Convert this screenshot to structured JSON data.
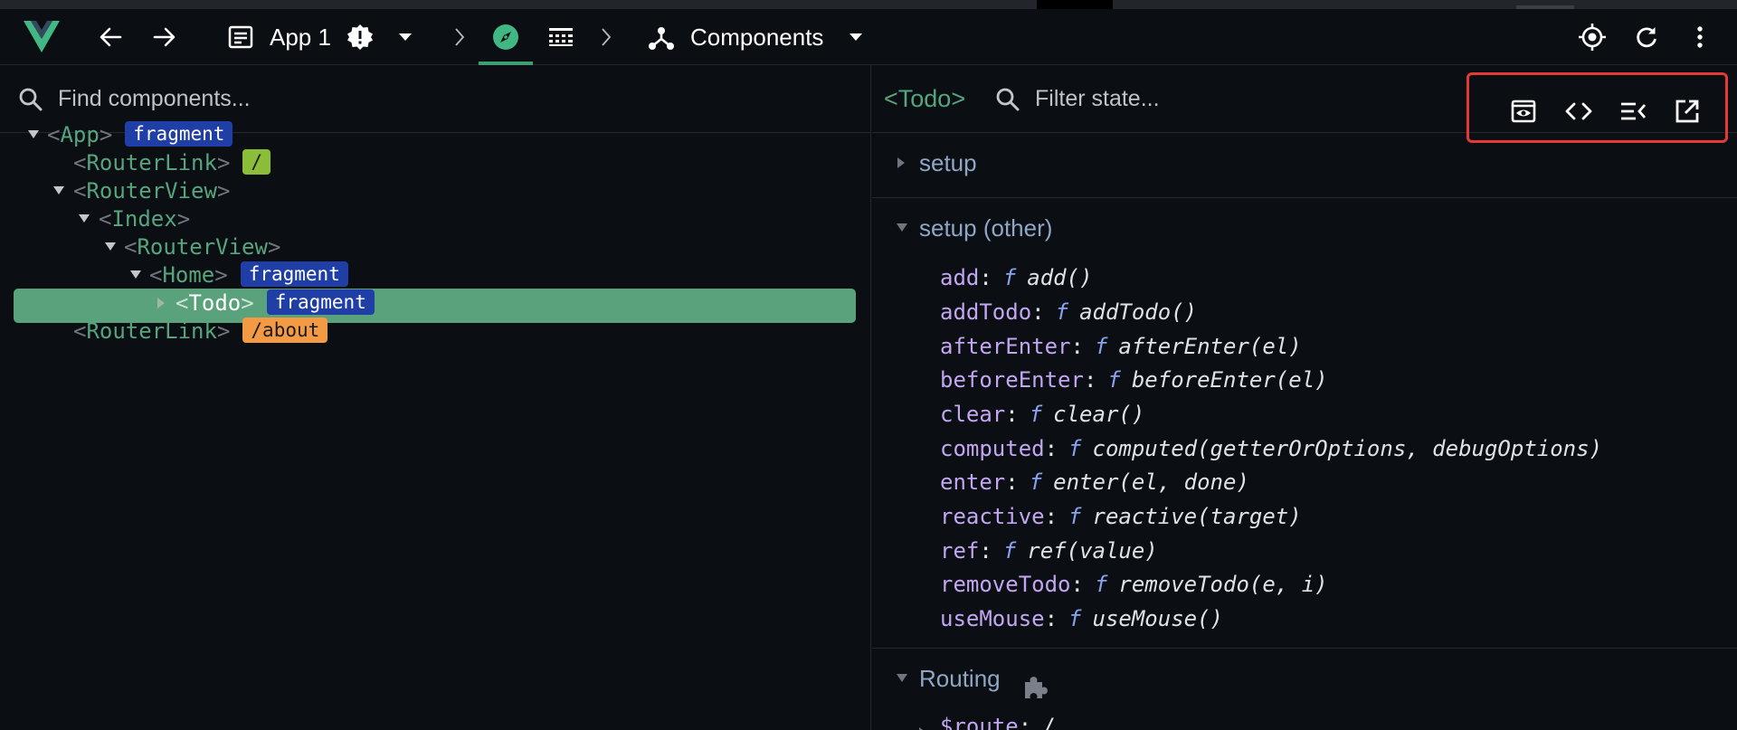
{
  "toolbar": {
    "app_name": "App 1",
    "components_label": "Components"
  },
  "left": {
    "search_placeholder": "Find components...",
    "tree": [
      {
        "name": "App",
        "badge": "fragment",
        "badge_color": "#1f3fa6"
      },
      {
        "name": "RouterLink",
        "badge": "/",
        "badge_color": "#8bbd38"
      },
      {
        "name": "RouterView",
        "badge": null
      },
      {
        "name": "Index",
        "badge": null
      },
      {
        "name": "RouterView",
        "badge": null
      },
      {
        "name": "Home",
        "badge": "fragment",
        "badge_color": "#1f3fa6"
      },
      {
        "name": "Todo",
        "badge": "fragment",
        "badge_color": "#1f3fa6",
        "selected": true
      },
      {
        "name": "RouterLink",
        "badge": "/about",
        "badge_color": "#f39a45"
      }
    ]
  },
  "right": {
    "component_name": "<Todo>",
    "filter_placeholder": "Filter state...",
    "sections": [
      {
        "label": "setup",
        "expanded": false
      },
      {
        "label": "setup (other)",
        "expanded": true
      },
      {
        "label": "Routing",
        "expanded": true
      }
    ],
    "setup_other": [
      {
        "key": "add",
        "f": "f",
        "value": "add()"
      },
      {
        "key": "addTodo",
        "f": "f",
        "value": "addTodo()"
      },
      {
        "key": "afterEnter",
        "f": "f",
        "value": "afterEnter(el)"
      },
      {
        "key": "beforeEnter",
        "f": "f",
        "value": "beforeEnter(el)"
      },
      {
        "key": "clear",
        "f": "f",
        "value": "clear()"
      },
      {
        "key": "computed",
        "f": "f",
        "value": "computed(getterOrOptions, debugOptions)"
      },
      {
        "key": "enter",
        "f": "f",
        "value": "enter(el, done)"
      },
      {
        "key": "reactive",
        "f": "f",
        "value": "reactive(target)"
      },
      {
        "key": "ref",
        "f": "f",
        "value": "ref(value)"
      },
      {
        "key": "removeTodo",
        "f": "f",
        "value": "removeTodo(e, i)"
      },
      {
        "key": "useMouse",
        "f": "f",
        "value": "useMouse()"
      }
    ],
    "routing_first_key": "$route",
    "routing_first_value": "/"
  },
  "colors": {
    "accent": "#56a57d",
    "selected_row": "#5aa27c",
    "highlight_box": "#e53935"
  }
}
